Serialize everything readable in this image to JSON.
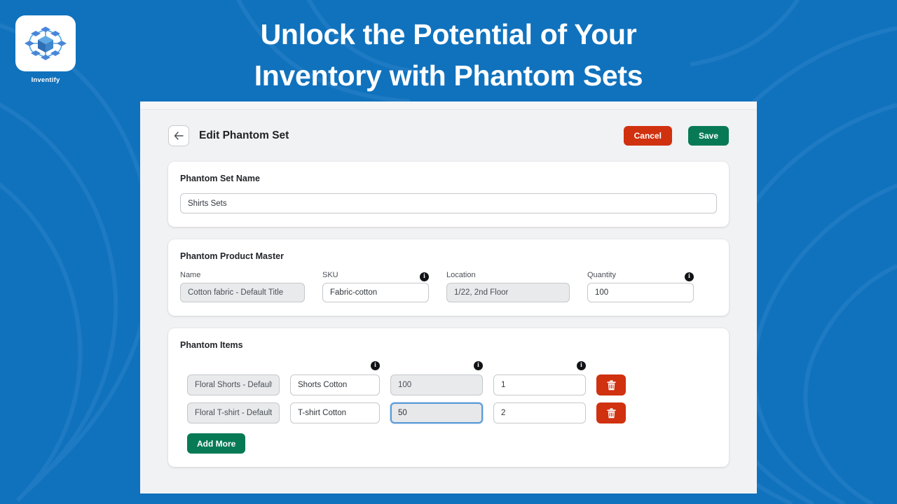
{
  "promo": {
    "headline_line1": "Unlock the Potential of Your",
    "headline_line2": "Inventory with Phantom Sets",
    "brand_name": "Inventify",
    "background_color": "#1072bd",
    "headline_color": "#ffffff"
  },
  "header": {
    "back_icon": "arrow-left-icon",
    "title": "Edit Phantom Set",
    "cancel_label": "Cancel",
    "save_label": "Save",
    "cancel_color": "#d0310f",
    "save_color": "#077a55"
  },
  "set_name_card": {
    "title": "Phantom Set Name",
    "value": "Shirts Sets",
    "placeholder": "Phantom Set Name"
  },
  "product_master": {
    "title": "Phantom Product Master",
    "fields": [
      {
        "label": "Name",
        "value": "Cotton fabric - Default Title",
        "readonly": true,
        "info": false
      },
      {
        "label": "SKU",
        "value": "Fabric-cotton",
        "readonly": false,
        "info": true
      },
      {
        "label": "Location",
        "value": "1/22, 2nd Floor",
        "readonly": true,
        "info": false
      },
      {
        "label": "Quantity",
        "value": "100",
        "readonly": false,
        "info": true
      }
    ]
  },
  "phantom_items": {
    "title": "Phantom Items",
    "header_info_icons": [
      false,
      true,
      true,
      true,
      false
    ],
    "rows": [
      {
        "name": "Floral Shorts - Default",
        "sku": "Shorts Cotton",
        "quantity": "100",
        "ratio": "1",
        "delete_icon": "trash-icon",
        "focused_field": ""
      },
      {
        "name": "Floral T-shirt - Default",
        "sku": "T-shirt Cotton",
        "quantity": "50",
        "ratio": "2",
        "delete_icon": "trash-icon",
        "focused_field": "quantity"
      }
    ],
    "add_more_label": "Add More",
    "add_more_color": "#077a55",
    "delete_color": "#d0310f",
    "focus_border_color": "#5b9bd8"
  },
  "icons": {
    "info": "i"
  }
}
